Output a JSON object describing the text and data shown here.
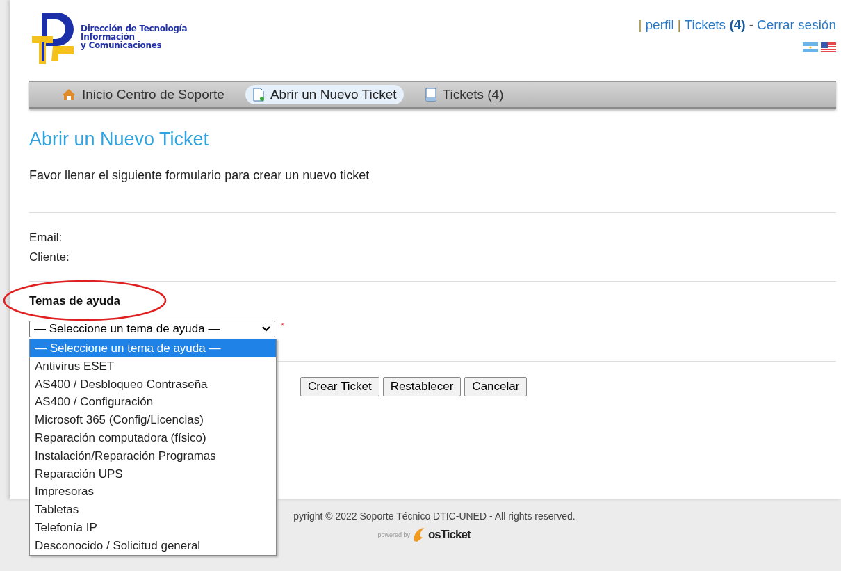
{
  "logo": {
    "lines": [
      "Dirección de Tecnología",
      "Información",
      "y Comunicaciones"
    ]
  },
  "user_links": {
    "sep1": "|",
    "profile": "perfil",
    "sep2": "|",
    "tickets": "Tickets",
    "tickets_count": "(4)",
    "dash": "-",
    "logout": "Cerrar sesión"
  },
  "nav": [
    {
      "label": "Inicio Centro de Soporte",
      "kind": "home",
      "selected": false
    },
    {
      "label": "Abrir un Nuevo Ticket",
      "kind": "new",
      "selected": true
    },
    {
      "label": "Tickets (4)",
      "kind": "list",
      "selected": false
    }
  ],
  "page_title": "Abrir un Nuevo Ticket",
  "intro": "Favor llenar el siguiente formulario para crear un nuevo ticket",
  "fields": [
    {
      "label": "Email:"
    },
    {
      "label": "Cliente:"
    }
  ],
  "help_topic": {
    "label": "Temas de ayuda",
    "value": "— Seleccione un tema de ayuda —",
    "required": "*",
    "expanded": true,
    "options": [
      {
        "label": "— Seleccione un tema de ayuda —",
        "selected": true
      },
      {
        "label": "Antivirus ESET",
        "selected": false
      },
      {
        "label": "AS400 / Desbloqueo Contraseña",
        "selected": false
      },
      {
        "label": "AS400 / Configuración",
        "selected": false
      },
      {
        "label": "Microsoft 365 (Config/Licencias)",
        "selected": false
      },
      {
        "label": "Reparación computadora (físico)",
        "selected": false
      },
      {
        "label": "Instalación/Reparación Programas",
        "selected": false
      },
      {
        "label": "Reparación UPS",
        "selected": false
      },
      {
        "label": "Impresoras",
        "selected": false
      },
      {
        "label": "Tabletas",
        "selected": false
      },
      {
        "label": "Telefonía IP",
        "selected": false
      },
      {
        "label": "Desconocido / Solicitud general",
        "selected": false
      }
    ]
  },
  "buttons": [
    "Crear Ticket",
    "Restablecer",
    "Cancelar"
  ],
  "footer": {
    "copyright": "pyright © 2022 Soporte Técnico DTIC-UNED - All rights reserved.",
    "powered_by": "powered by",
    "brand": "osTicket"
  }
}
